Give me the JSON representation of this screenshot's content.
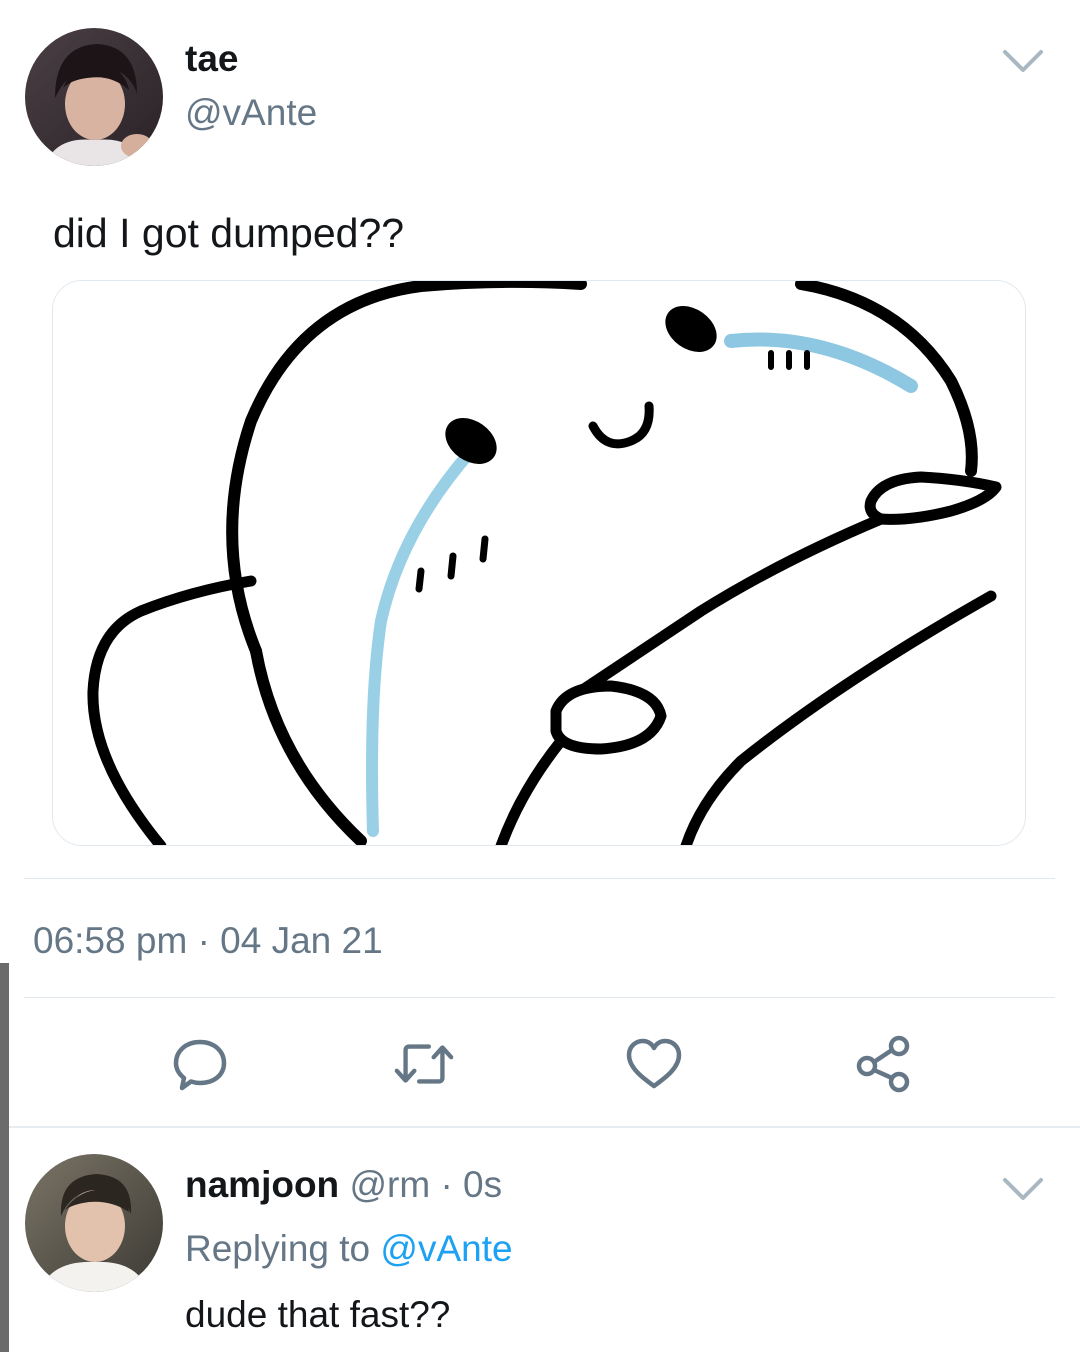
{
  "tweet": {
    "author_name": "tae",
    "author_handle": "@vAnte",
    "text": "did I got dumped??",
    "time": "06:58 pm",
    "separator": "·",
    "date": "04 Jan 21"
  },
  "actions": [
    {
      "icon": "reply-icon"
    },
    {
      "icon": "retweet-icon"
    },
    {
      "icon": "like-icon"
    },
    {
      "icon": "share-icon"
    }
  ],
  "reply": {
    "author_name": "namjoon",
    "author_handle": "@rm",
    "separator": "·",
    "time": "0s",
    "replying_prefix": "Replying to",
    "replying_handle": "@vAnte",
    "text": "dude that fast??"
  },
  "colors": {
    "text_primary": "#14171a",
    "text_secondary": "#657786",
    "link": "#1da1f2",
    "divider": "#e1e8ed",
    "tear": "#8ecae6"
  }
}
